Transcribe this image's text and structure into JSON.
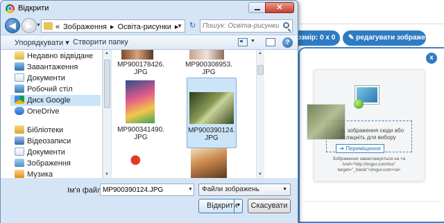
{
  "background": {
    "size_button": "озмір: 0 x 0",
    "edit_button": "редагувати зображення",
    "close_label": "x",
    "drop_text": "...ть зображення сюди або клацніть для вибору",
    "move_button": "Переміщення",
    "note_text": "Зображення завантажується на <a href=\"http://imgur.com/tos\" target=\"_blank\">imgur.com</a>"
  },
  "dialog": {
    "title": "Відкрити",
    "close_glyph": "✕",
    "breadcrumb": [
      "«",
      "Зображення",
      "▸",
      "Освіта-рисунки",
      "▸"
    ],
    "search_placeholder": "Пошук: Освіта-рисунки",
    "toolbar": {
      "organize": "Упорядкувати ▾",
      "new_folder": "Створити папку"
    },
    "nav": {
      "favorites": [
        {
          "label": "Недавно відвідане",
          "icon": "recent-places-icon"
        },
        {
          "label": "Завантаження",
          "icon": "downloads-icon"
        },
        {
          "label": "Документи",
          "icon": "documents-icon"
        },
        {
          "label": "Робочий стіл",
          "icon": "desktop-icon"
        },
        {
          "label": "Диск Google",
          "icon": "google-drive-icon"
        },
        {
          "label": "OneDrive",
          "icon": "onedrive-icon"
        }
      ],
      "libraries_label": "Бібліотеки",
      "libraries": [
        {
          "label": "Відеозаписи",
          "icon": "videos-icon"
        },
        {
          "label": "Документи",
          "icon": "documents-icon"
        },
        {
          "label": "Зображення",
          "icon": "pictures-icon"
        },
        {
          "label": "Музика",
          "icon": "music-icon"
        }
      ]
    },
    "files": [
      {
        "name": "MP900178426.JPG"
      },
      {
        "name": "MP900308953.JPG"
      },
      {
        "name": "MP900341490.JPG"
      },
      {
        "name": "MP900390124.JPG",
        "selected": true
      },
      {
        "name": ""
      },
      {
        "name": ""
      }
    ],
    "filename_label": "Ім'я файлу:",
    "filename_value": "MP900390124.JPG",
    "filetype_value": "Файли зображень",
    "open_button": "Відкрити",
    "cancel_button": "Скасувати"
  }
}
